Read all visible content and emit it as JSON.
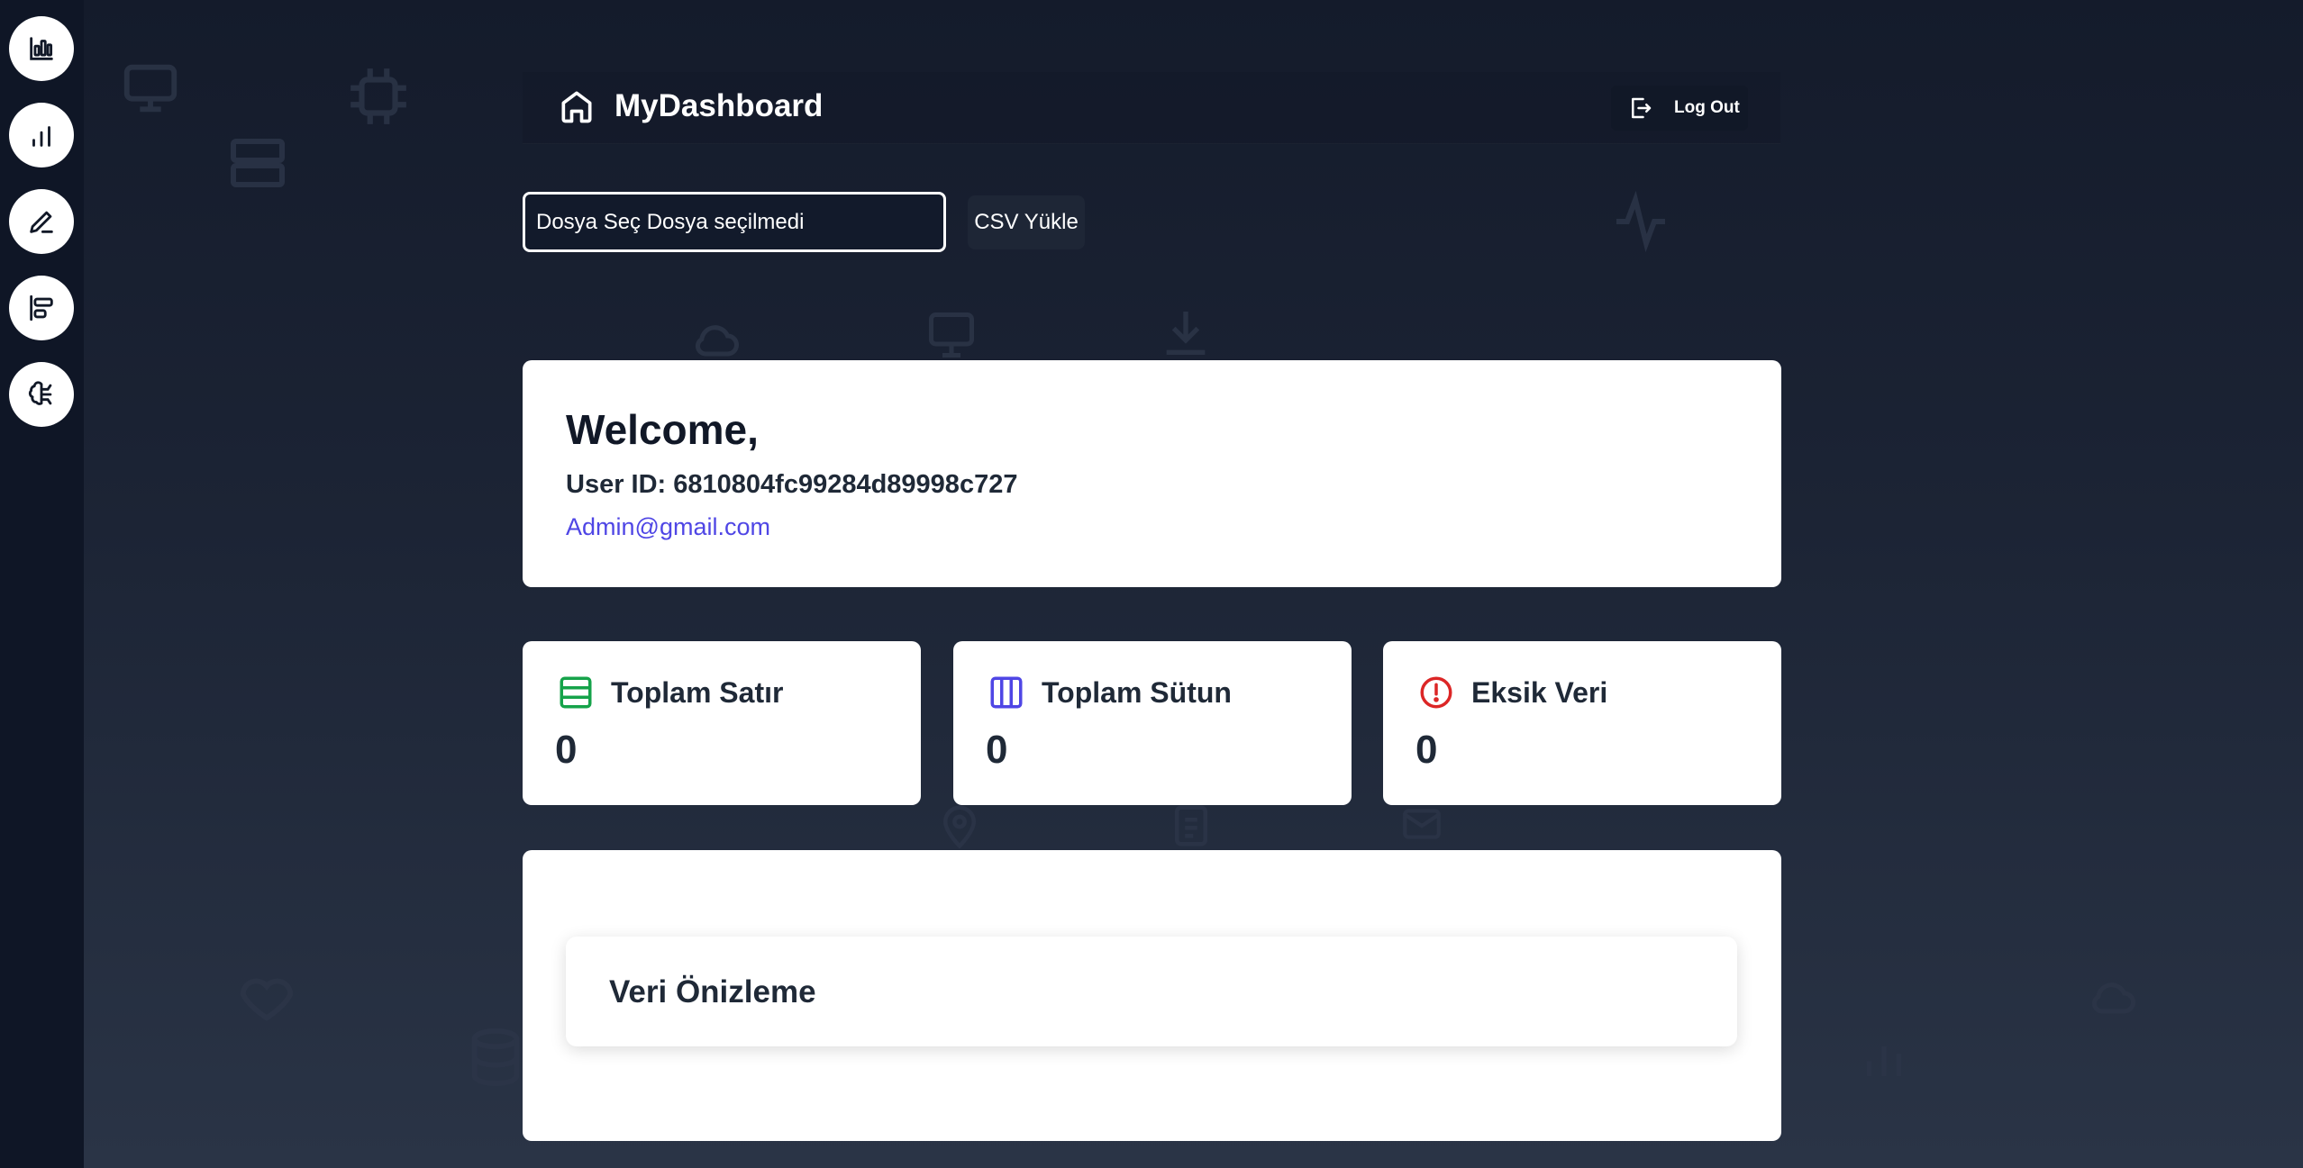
{
  "sidebar": {
    "items": [
      {
        "icon": "bar-chart-box-icon"
      },
      {
        "icon": "bar-chart-icon"
      },
      {
        "icon": "pencil-icon"
      },
      {
        "icon": "align-left-icon"
      },
      {
        "icon": "brain-icon"
      }
    ]
  },
  "header": {
    "brand_title": "MyDashboard",
    "logout_label": "Log Out"
  },
  "upload": {
    "file_input_text": "Dosya Seç Dosya seçilmedi",
    "upload_button_label": "CSV Yükle"
  },
  "welcome": {
    "title": "Welcome,",
    "user_id": "User ID: 6810804fc99284d89998c727",
    "email": "Admin@gmail.com"
  },
  "stats": [
    {
      "label": "Toplam Satır",
      "value": "0",
      "icon": "rows-icon",
      "color": "#16a34a"
    },
    {
      "label": "Toplam Sütun",
      "value": "0",
      "icon": "columns-icon",
      "color": "#4f46e5"
    },
    {
      "label": "Eksik Veri",
      "value": "0",
      "icon": "alert-circle-icon",
      "color": "#dc2626"
    }
  ],
  "preview": {
    "title": "Veri Önizleme"
  },
  "colors": {
    "background": "#1c2435",
    "sidebar": "#0f1626",
    "link": "#4f46e5"
  }
}
